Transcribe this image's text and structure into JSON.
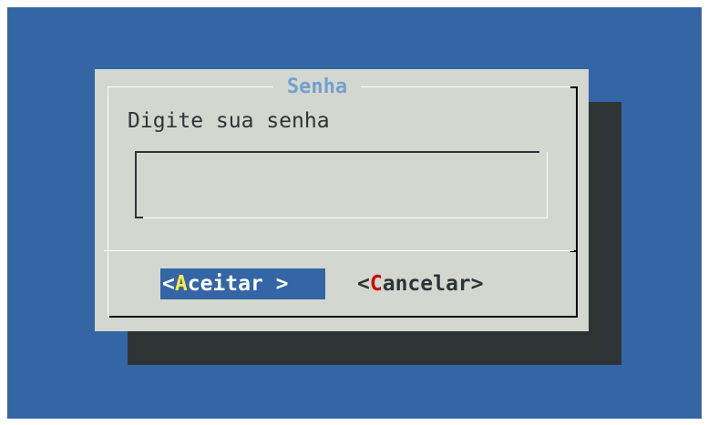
{
  "dialog": {
    "title": "Senha",
    "prompt": "Digite sua senha",
    "password_value": ""
  },
  "buttons": {
    "accept": {
      "open": "<",
      "hotkey": "A",
      "rest": "ceitar",
      "close": " >"
    },
    "cancel": {
      "open": "<",
      "hotkey": "C",
      "rest": "ancelar",
      "close": ">"
    }
  },
  "colors": {
    "screen_background": "#3465a4",
    "dialog_background": "#d3d7cf",
    "shadow": "#2e3436",
    "title": "#729fcf",
    "selected_button": "#3465a4",
    "hotkey_selected": "#fce94f",
    "hotkey_unselected": "#cc0000"
  }
}
